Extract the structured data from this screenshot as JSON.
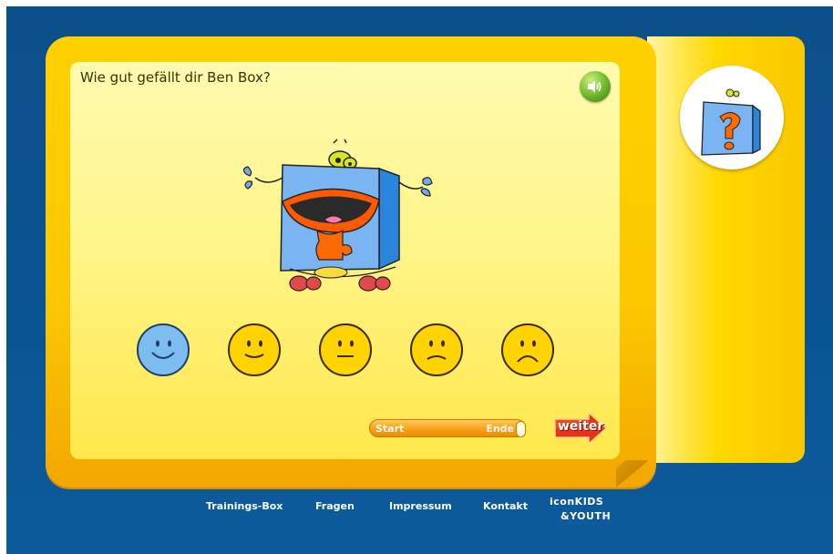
{
  "question": "Wie gut gefällt dir Ben Box?",
  "rating": {
    "options": [
      "sehr gut",
      "gut",
      "mittel",
      "schlecht",
      "sehr schlecht"
    ],
    "selected_index": 0
  },
  "progress": {
    "start_label": "Start",
    "end_label": "Ende",
    "value": 1.0
  },
  "next_button": {
    "label": "weiter"
  },
  "footer": {
    "links": [
      "Trainings-Box",
      "Fragen",
      "Impressum",
      "Kontakt"
    ],
    "logo_line1": "iconKIDS",
    "logo_line2": "&YOUTH"
  },
  "colors": {
    "background": "#0c4f8a",
    "panel": "#ffd100",
    "card": "#fff58a",
    "selected_face": "#7cbcf0",
    "face": "#ffd300",
    "next_button": "#e8321a"
  },
  "icons": {
    "sound": "speaker-icon",
    "mascot": "ben-box-mascot",
    "avatar": "ben-box-avatar"
  }
}
